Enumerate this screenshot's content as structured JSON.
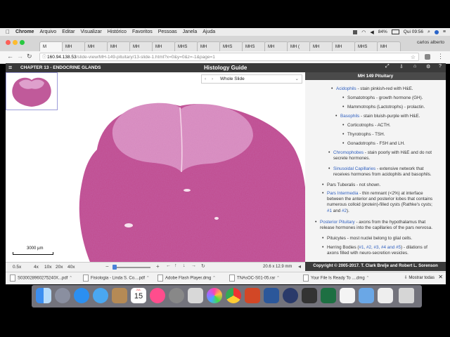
{
  "menubar": {
    "app": "Chrome",
    "items": [
      "Arquivo",
      "Editar",
      "Visualizar",
      "Histórico",
      "Favoritos",
      "Pessoas",
      "Janela",
      "Ajuda"
    ],
    "battery": "84%",
    "clock": "Qui 09:56"
  },
  "browser": {
    "tabs": [
      "M",
      "MH",
      "MH",
      "MH",
      "MH",
      "MH",
      "MHS",
      "MH",
      "MHS",
      "MHS",
      "MH",
      "MH (",
      "MH",
      "MH",
      "MHS",
      "MH"
    ],
    "profile": "carlos alberto",
    "url_host": "160.94.138.53",
    "url_path": "/slide-view/MH-149-pituitary/13-slide-1.html?x=0&y=0&z=-1&page=1"
  },
  "app_header": {
    "chapter": "CHAPTER 13 - ENDOCRINE GLANDS",
    "title": "Histology Guide"
  },
  "viewer": {
    "view_select": "Whole Slide",
    "scale_label": "3000 µm",
    "zoom_levels": [
      "0.5x",
      "4x",
      "10x",
      "20x",
      "40x"
    ],
    "dimensions": "20.6 x 12.9 mm"
  },
  "sidebar": {
    "slide_title": "MH 149 Pituitary",
    "acidophils_link": "Acidophils",
    "acidophils_text": " - stain pinkish-red with H&E.",
    "somatotrophs": "Somatotrophs - growth hormone (GH).",
    "mammotrophs": "Mammotrophs (Lactotrophs) - prolactin.",
    "basophils_link": "Basophils",
    "basophils_text": " - stain bluish-purple with H&E.",
    "corticotrophs": "Corticotrophs - ACTH.",
    "thyrotrophs": "Thyrotrophs - TSH.",
    "gonadotrophs": "Gonadotrophs - FSH and LH.",
    "chromophobes_link": "Chromophobes",
    "chromophobes_line1": " - stain poorly with H&E and do not",
    "chromophobes_line2": "secrete hormones.",
    "sinusoidal_link": "Sinusoidal Capillaries",
    "sinusoidal_line1": " - extensive network that",
    "sinusoidal_line2": "receives hormones from acidophils and basophils.",
    "tuberalis": "Pars Tuberalis - not shown.",
    "intermedia_link": "Pars Intermedia",
    "intermedia_line1": " - thin remnant (<2%) at interface",
    "intermedia_line2": "between the anterior and posterior lobes that contains",
    "intermedia_line3": "numerous colloid (protein)-filled cysts (Rathke's cysts;",
    "intermedia_ref1": "#1",
    "intermedia_and": " and ",
    "intermedia_ref2": "#2",
    "intermedia_end": ").",
    "posterior_link": "Posterior Pituitary",
    "posterior_line1": " - axons from the hypothalamus that",
    "posterior_line2": "release hormones into the capillaries of the pars nervosa.",
    "pituicytes": "Pituicytes - most nuclei belong to glial cells.",
    "herring_start": "Herring Bodies (",
    "herring_refs": "#1, #2, #3, #4 and #5",
    "herring_line1_end": ") - dilations of",
    "herring_line2": "axons filled with neuro-secretion vesicles.",
    "copyright": "Copyright © 2005-2017. T. Clark Brelje and Robert L. Sorenson"
  },
  "downloads": {
    "items": [
      "S03002896027524​0X...pdf",
      "Fisiologia - Linda S. Co....pdf",
      "Adobe Flash Player.dmg",
      "TNAsOC-S01-05.rar",
      "Your File Is Ready To ....dmg"
    ],
    "show_all": "Mostrar todas"
  },
  "dock": {
    "calendar_month": "JUL",
    "calendar_day": "15"
  }
}
